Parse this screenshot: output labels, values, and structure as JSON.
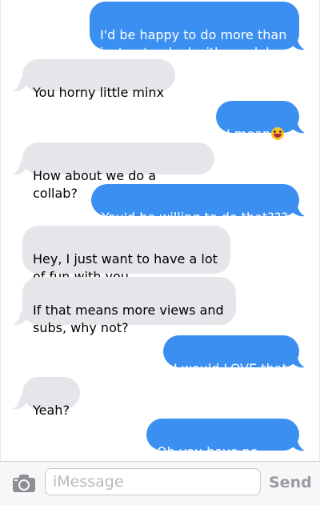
{
  "messages": [
    {
      "direction": "sent",
      "text": "I'd be happy to do more than\njust get naked with you lol"
    },
    {
      "direction": "received",
      "text": "You horny little minx"
    },
    {
      "direction": "sent",
      "text": "I mean",
      "emoji": "star-struck-emoji"
    },
    {
      "direction": "received",
      "text": "How about we do a collab?"
    },
    {
      "direction": "sent",
      "text": "You'd be willing to do that???"
    },
    {
      "direction": "received",
      "text": "Hey, I just want to have a lot\nof fun with you"
    },
    {
      "direction": "received",
      "text": "If that means more views and\nsubs, why not?"
    },
    {
      "direction": "sent",
      "text": "I would LOVE that"
    },
    {
      "direction": "received",
      "text": "Yeah?"
    },
    {
      "direction": "sent",
      "text": "Oh you have no idea"
    }
  ],
  "composer": {
    "camera_icon": "camera-icon",
    "placeholder": "iMessage",
    "send_label": "Send"
  },
  "colors": {
    "sent_bubble": "#3b8ff0",
    "received_bubble": "#e5e5ea"
  }
}
